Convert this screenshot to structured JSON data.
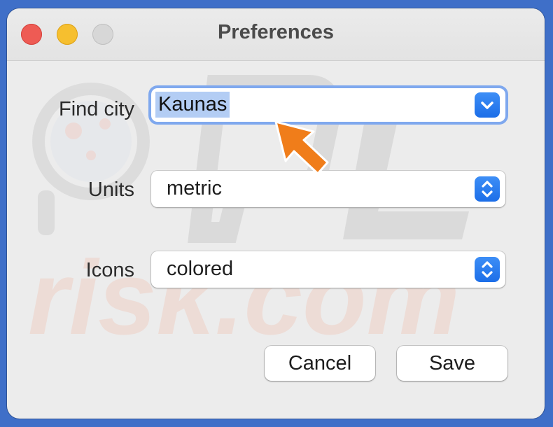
{
  "window": {
    "title": "Preferences"
  },
  "form": {
    "city": {
      "label": "Find city",
      "value": "Kaunas"
    },
    "units": {
      "label": "Units",
      "value": "metric"
    },
    "icons": {
      "label": "Icons",
      "value": "colored"
    }
  },
  "actions": {
    "cancel_label": "Cancel",
    "save_label": "Save"
  },
  "watermark": {
    "text": "PC risk.com"
  },
  "colors": {
    "accent": "#1c6ee8",
    "focus_ring": "#7fa8ee",
    "selection": "#b3cdf4",
    "cursor": "#f07d1a"
  },
  "icons": {
    "close": "close-icon",
    "minimize": "minimize-icon",
    "zoom": "zoom-icon",
    "dropdown": "chevron-down-icon",
    "stepper": "up-down-chevron-icon",
    "pointer": "arrow-cursor-icon"
  }
}
